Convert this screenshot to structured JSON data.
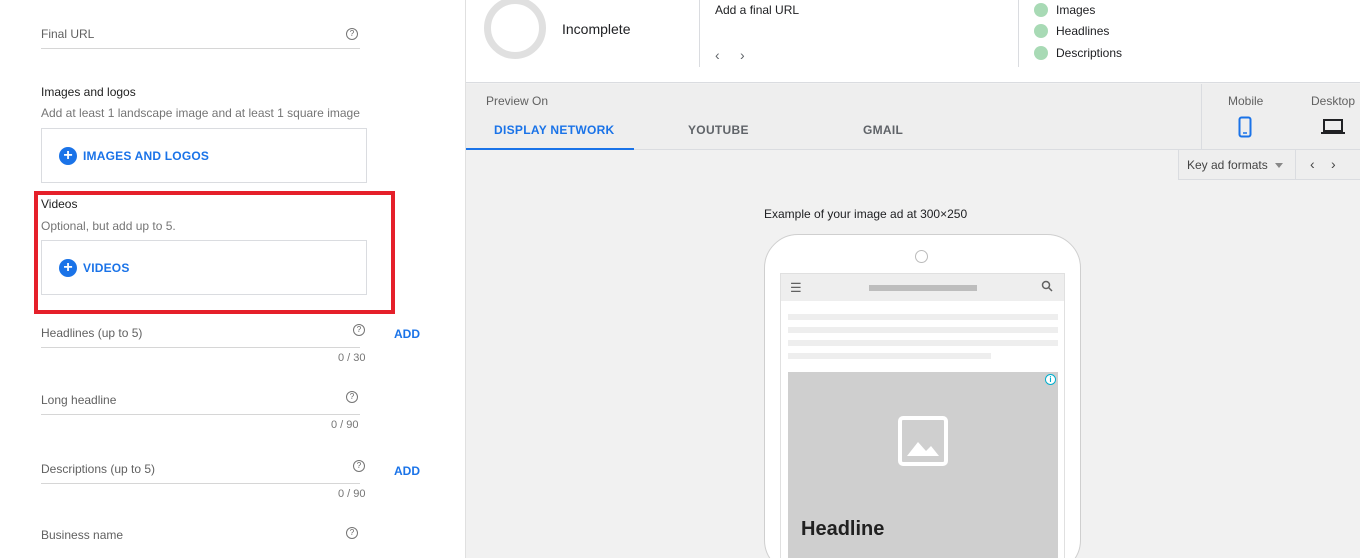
{
  "form": {
    "final_url": {
      "label": "Final URL"
    },
    "images": {
      "title": "Images and logos",
      "subtitle": "Add at least 1 landscape image and at least 1 square image",
      "button": "IMAGES AND LOGOS"
    },
    "videos": {
      "title": "Videos",
      "subtitle": "Optional, but add up to 5.",
      "button": "VIDEOS"
    },
    "headlines": {
      "label": "Headlines (up to 5)",
      "counter": "0 / 30",
      "add": "ADD"
    },
    "long_headline": {
      "label": "Long headline",
      "counter": "0 / 90"
    },
    "descriptions": {
      "label": "Descriptions (up to 5)",
      "counter": "0 / 90",
      "add": "ADD"
    },
    "business_name": {
      "label": "Business name"
    }
  },
  "status": {
    "strength": "Incomplete",
    "message": "Add a final URL",
    "checklist": [
      "Images",
      "Headlines",
      "Descriptions"
    ]
  },
  "preview": {
    "label": "Preview On",
    "tabs": [
      "DISPLAY NETWORK",
      "YOUTUBE",
      "GMAIL"
    ],
    "active_tab": "DISPLAY NETWORK",
    "devices": [
      "Mobile",
      "Desktop"
    ],
    "format_select": "Key ad formats",
    "example_caption": "Example of your image ad at 300×250",
    "ad_headline": "Headline"
  },
  "colors": {
    "accent": "#1a73e8",
    "highlight": "#e5202a",
    "check_dot": "#a8dab5"
  }
}
